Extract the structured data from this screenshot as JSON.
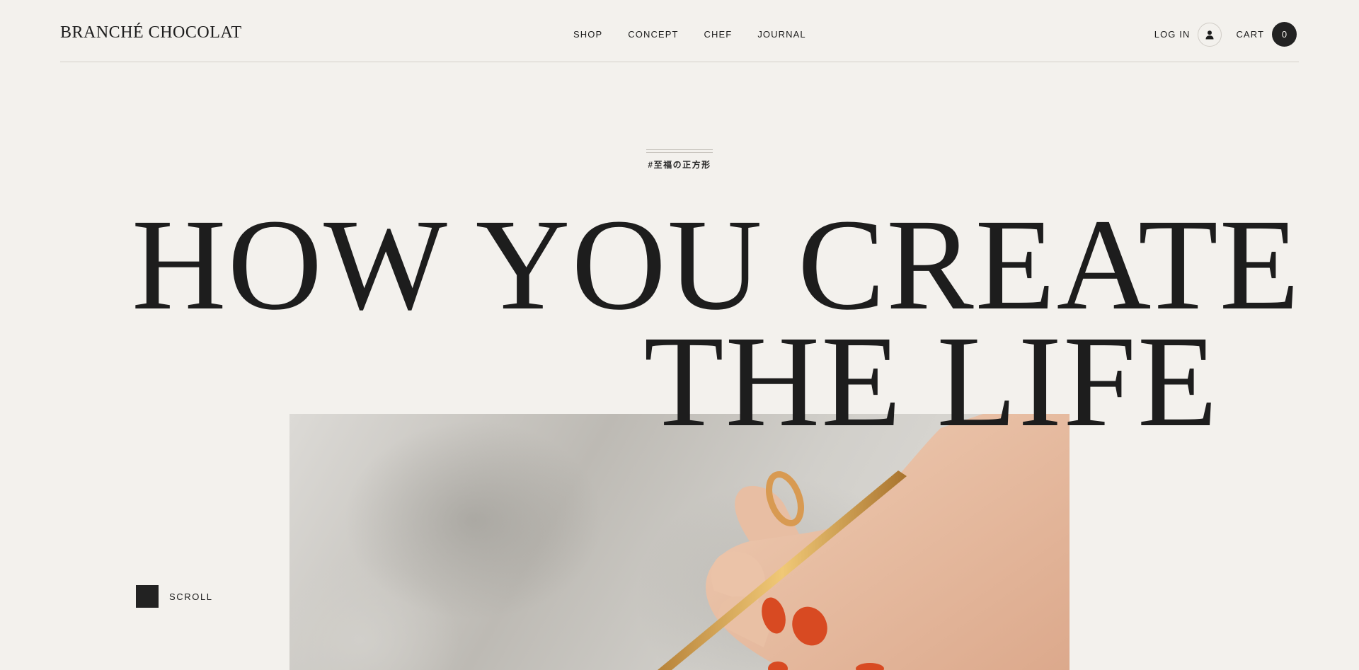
{
  "header": {
    "logo": "BRANCHÉ CHOCOLAT",
    "nav": [
      {
        "label": "SHOP"
      },
      {
        "label": "CONCEPT"
      },
      {
        "label": "CHEF"
      },
      {
        "label": "JOURNAL"
      }
    ],
    "login_label": "LOG IN",
    "user_icon": "user-icon",
    "cart_label": "CART",
    "cart_count": "0"
  },
  "hero": {
    "tagline": "#至福の正方形",
    "headline_line1": "HOW YOU CREATE",
    "headline_line2": "THE LIFE",
    "image_subject": "hand-holding-gold-pen"
  },
  "scroll": {
    "label": "SCROLL"
  },
  "colors": {
    "background": "#f3f1ed",
    "text": "#1d1d1d",
    "dark_accent": "#222222",
    "nail_polish": "#d84a22",
    "pen_gold": "#d4a04a"
  }
}
